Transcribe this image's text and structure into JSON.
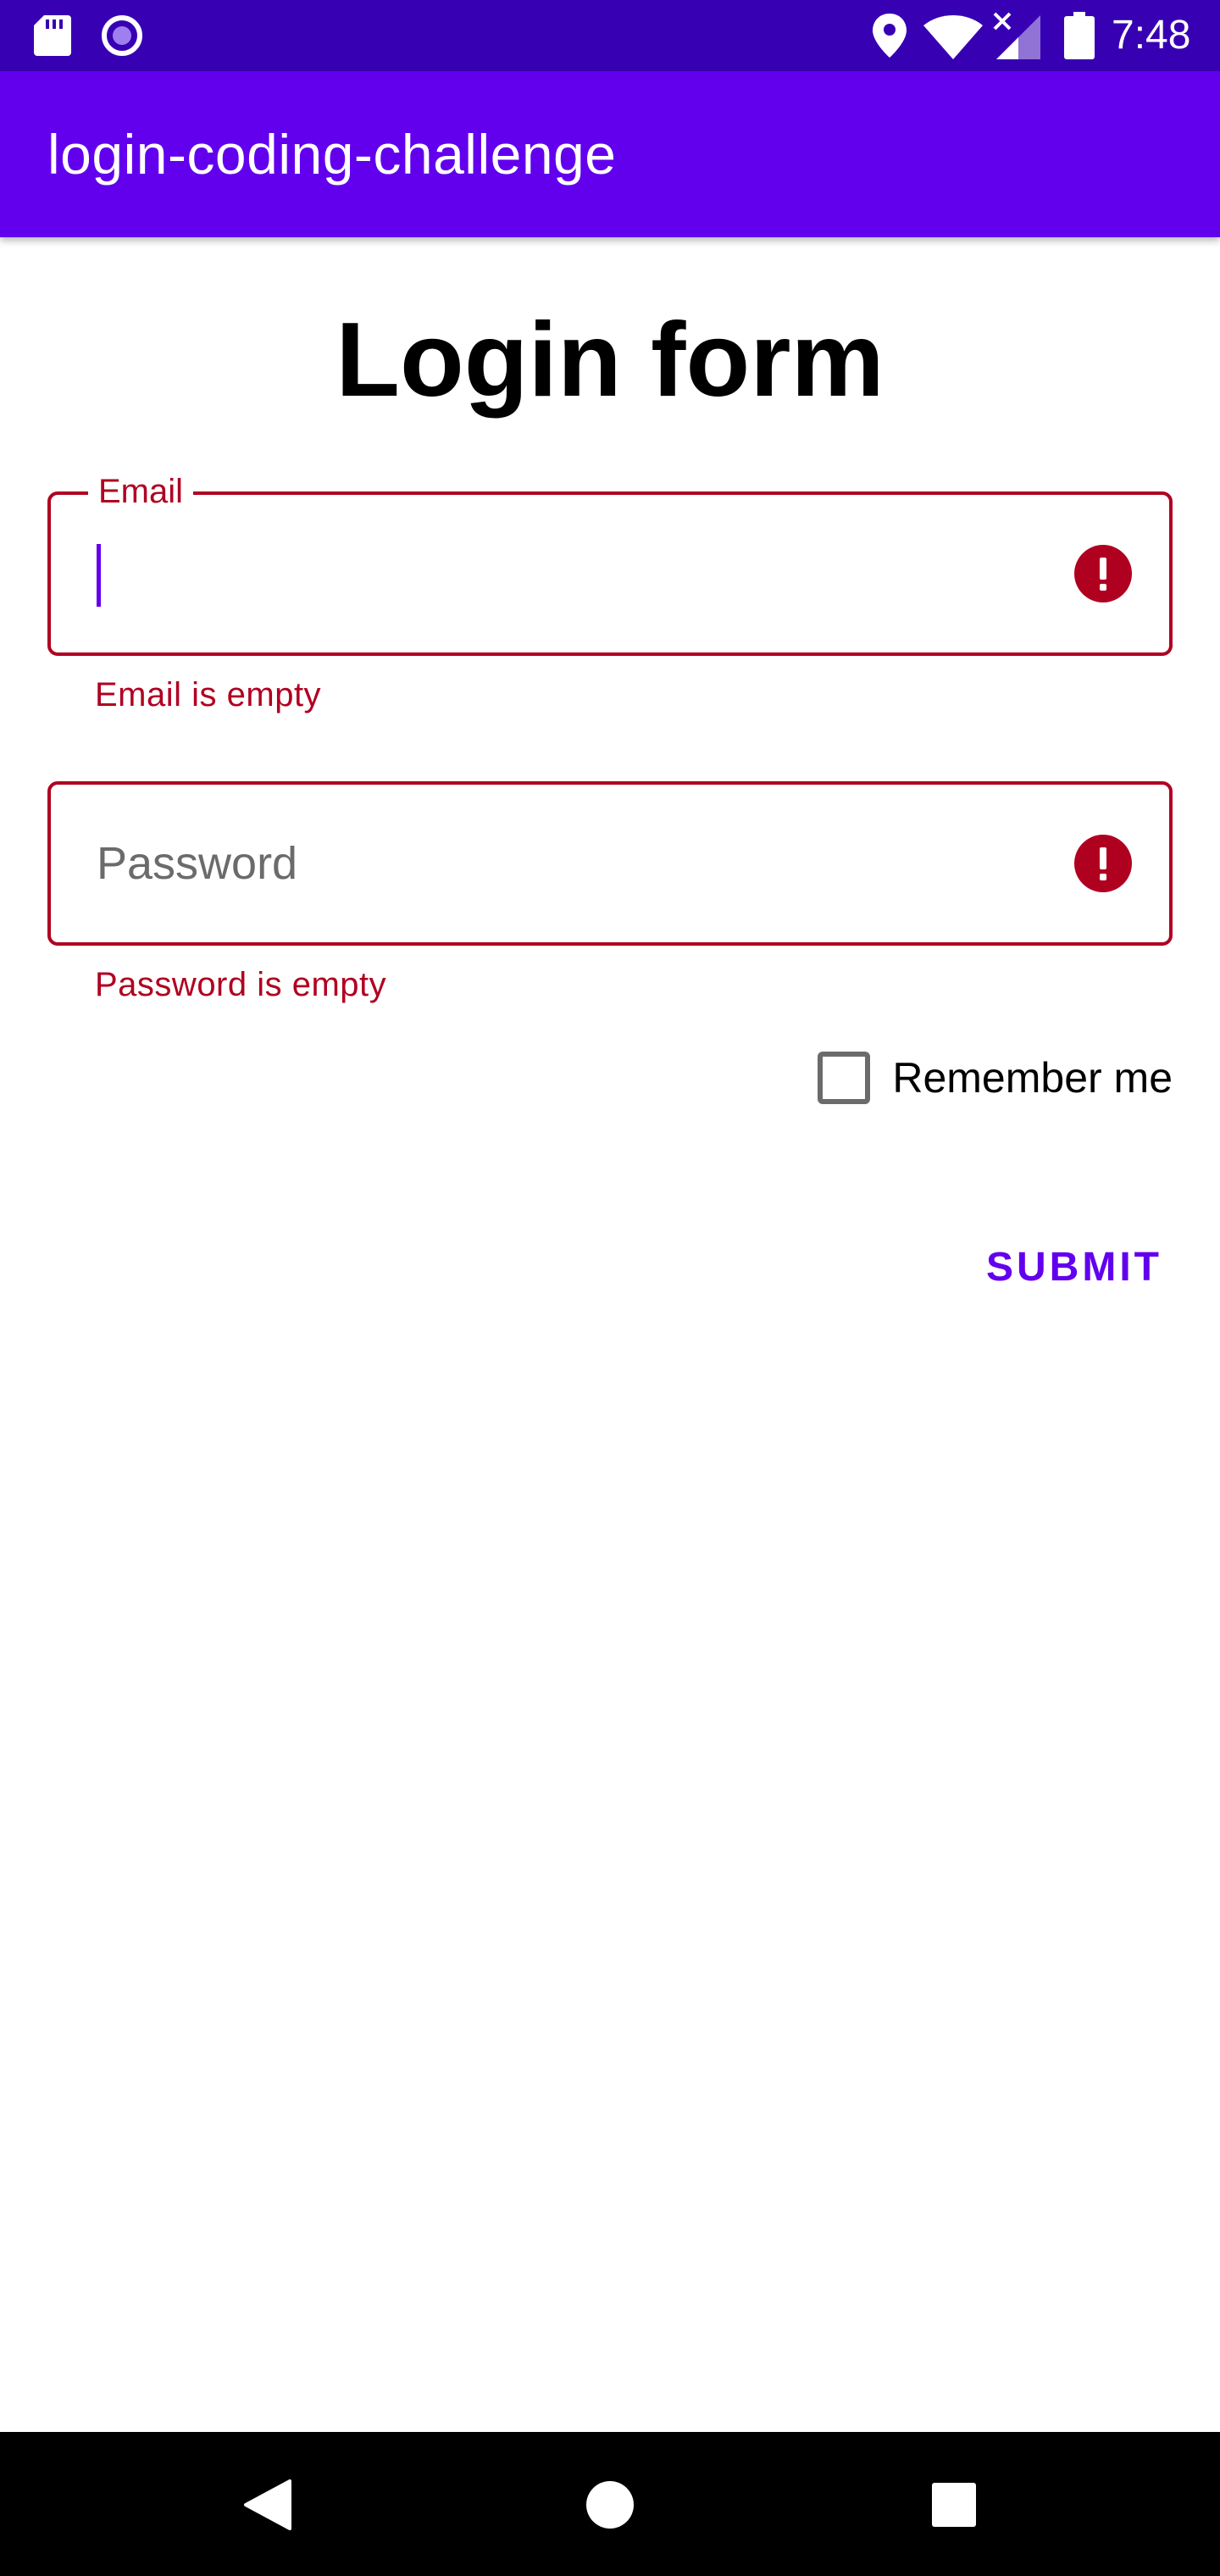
{
  "status_bar": {
    "time": "7:48",
    "icons": [
      "sd-card-icon",
      "radio-icon",
      "location-icon",
      "wifi-icon",
      "signal-icon",
      "battery-icon"
    ]
  },
  "app_bar": {
    "title": "login-coding-challenge"
  },
  "form": {
    "heading": "Login form",
    "email": {
      "label": "Email",
      "value": "",
      "error": "Email is empty",
      "focused": true
    },
    "password": {
      "placeholder": "Password",
      "value": "",
      "error": "Password is empty"
    },
    "remember_me": {
      "label": "Remember me",
      "checked": false
    },
    "submit_label": "SUBMIT"
  },
  "nav_bar": {
    "icons": [
      "back-icon",
      "home-icon",
      "recents-icon"
    ]
  },
  "colors": {
    "status_bar": "#3700b3",
    "primary": "#6200ee",
    "error": "#b00020",
    "nav_bar": "#000000"
  }
}
